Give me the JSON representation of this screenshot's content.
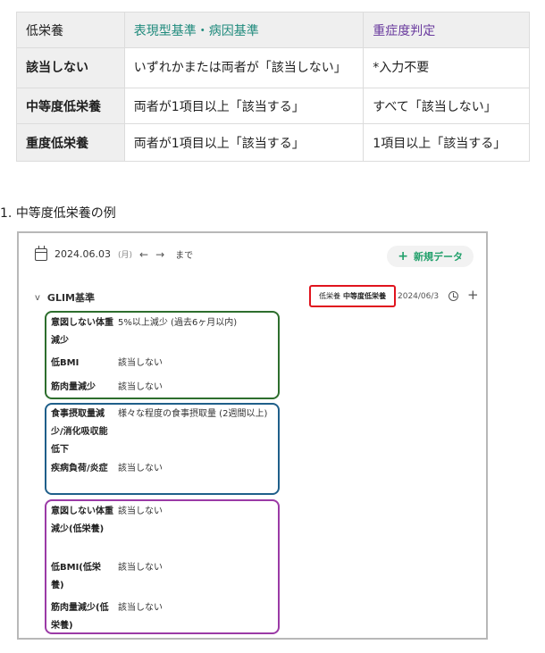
{
  "table": {
    "headers": [
      "低栄養",
      "表現型基準・病因基準",
      "重症度判定"
    ],
    "rows": [
      [
        "該当しない",
        "いずれかまたは両者が「該当しない」",
        "*入力不要"
      ],
      [
        "中等度低栄養",
        "両者が1項目以上「該当する」",
        "すべて「該当しない」"
      ],
      [
        "重度低栄養",
        "両者が1項目以上「該当する」",
        "1項目以上「該当する」"
      ]
    ]
  },
  "list": {
    "number": "1.",
    "text": "中等度低栄養の例"
  },
  "screenshot": {
    "date": "2024.06.03",
    "weekday": "(月)",
    "prev_arrow": "←",
    "next_arrow": "→",
    "until": "まで",
    "new_button": "新規データ",
    "chevron": "v",
    "section_title": "GLIM基準",
    "badge_label": "低栄養",
    "badge_value": "中等度低栄養",
    "record_date": "2024/06/3",
    "groups": {
      "phenotypic": [
        {
          "label": "意図しない体重減少",
          "value": "5%以上減少 (過去6ヶ月以内)"
        },
        {
          "label": "低BMI",
          "value": "該当しない"
        },
        {
          "label": "筋肉量減少",
          "value": "該当しない"
        }
      ],
      "etiologic": [
        {
          "label": "食事摂取量減少/消化吸収能低下",
          "value": "様々な程度の食事摂取量 (2週間以上)"
        },
        {
          "label": "疾病負荷/炎症",
          "value": "該当しない"
        }
      ],
      "severity": [
        {
          "label": "意図しない体重減少(低栄養)",
          "value": "該当しない"
        },
        {
          "label": "低BMI(低栄養)",
          "value": "該当しない"
        },
        {
          "label": "筋肉量減少(低栄養)",
          "value": "該当しない"
        }
      ]
    }
  },
  "colors": {
    "teal_header": "#1f8a7c",
    "purple_header": "#6a3b9e",
    "new_button": "#22a06b",
    "badge_border": "#e0141e",
    "group_green": "#2d6e2d",
    "group_blue": "#1f5f8a",
    "group_purple": "#9b3aa6"
  }
}
